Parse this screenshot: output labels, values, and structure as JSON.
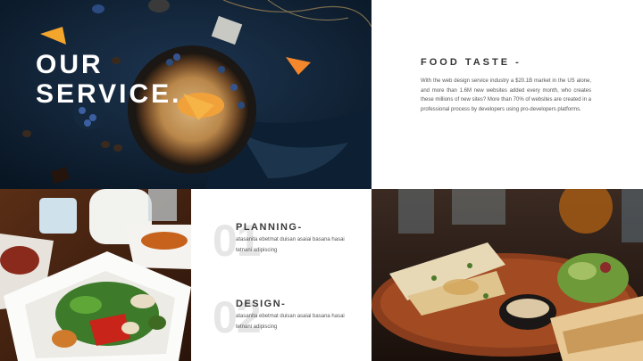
{
  "hero": {
    "title_line1": "OUR",
    "title_line2": "SERVICE."
  },
  "food_taste": {
    "heading": "FOOD TASTE -",
    "body": "With the web design service industry a $20.1B market in the US alone, and more than 1.6M new websites added every month, who creates these millions of new sites? More than 70% of websites are created in a professional process by developers using pro-developers platforms."
  },
  "services": [
    {
      "number": "01",
      "title": "PLANNING-",
      "description": "atasanita ebetmat duisan asaiai basana hasai tetnani adipiscing"
    },
    {
      "number": "02",
      "title": "DESIGN-",
      "description": "atasanita ebetmat duisan asaiai basana hasai tetnani adipiscing"
    }
  ],
  "images": {
    "pan": "dark-table-pancake-photo",
    "salad": "grilled-vegetable-salad-photo",
    "platter": "seafood-platter-photo"
  },
  "colors": {
    "text_dark": "#333333",
    "number_watermark": "#e6e6e6",
    "hero_text": "#ffffff"
  }
}
